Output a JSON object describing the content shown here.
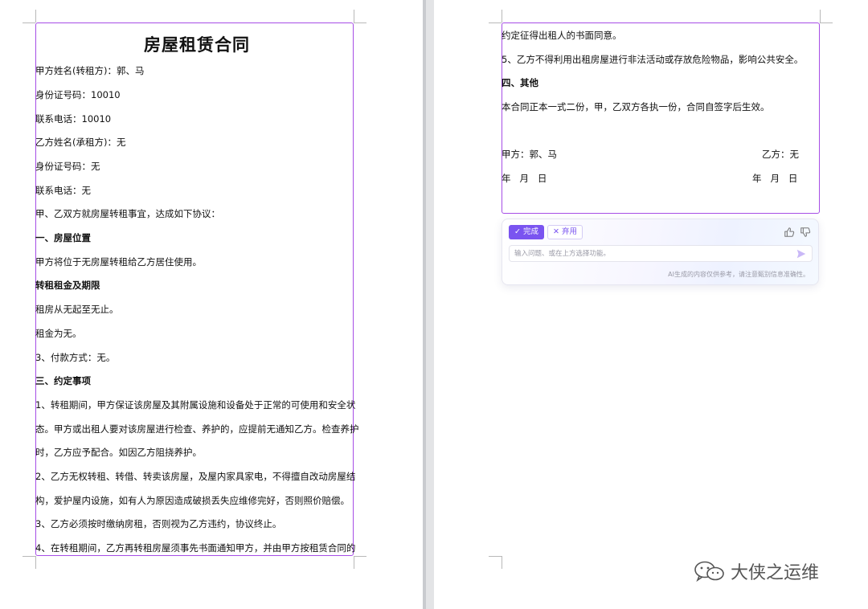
{
  "left_page": {
    "title": "房屋租赁合同",
    "lines": [
      "甲方姓名(转租方)：郭、马",
      "身份证号码：10010",
      "联系电话：10010",
      "乙方姓名(承租方)：无",
      "身份证号码：无",
      "联系电话：无",
      "甲、乙双方就房屋转租事宜，达成如下协议：",
      "一、房屋位置",
      "甲方将位于无房屋转租给乙方居住使用。",
      "转租租金及期限",
      "租房从无起至无止。",
      "租金为无。",
      "3、付款方式：无。",
      "三、约定事项",
      "1、转租期间，甲方保证该房屋及其附属设施和设备处于正常的可使用和安全状",
      "态。甲方或出租人要对该房屋进行检查、养护的，应提前无通知乙方。检查养护",
      "时，乙方应予配合。如因乙方阻挠养护。",
      "2、乙方无权转租、转借、转卖该房屋，及屋内家具家电，不得擅自改动房屋结",
      "构，爱护屋内设施，如有人为原因造成破损丢失应维修完好，否则照价赔偿。",
      "3、乙方必须按时缴纳房租，否则视为乙方违约，协议终止。",
      "4、在转租期间，乙方再转租房屋须事先书面通知甲方，并由甲方按租赁合同的"
    ]
  },
  "right_page": {
    "lines": [
      "约定征得出租人的书面同意。",
      "5、乙方不得利用出租房屋进行非法活动或存放危险物品，影响公共安全。",
      "四、其他",
      "本合同正本一式二份，甲，乙双方各执一份，合同自签字后生效。"
    ],
    "sign_left": "甲方：郭、马",
    "sign_right": "乙方：无",
    "date_left": "年   月   日",
    "date_right": "年   月   日"
  },
  "ai_panel": {
    "done_label": "完成",
    "discard_label": "弃用",
    "input_placeholder": "输入问题、或在上方选择功能。",
    "disclaimer": "AI生成的内容仅供参考，请注意甄别信息准确性。"
  },
  "watermark": {
    "text": "大侠之运维"
  },
  "colors": {
    "accent": "#7a54f0",
    "selection_frame": "#a64de6"
  }
}
